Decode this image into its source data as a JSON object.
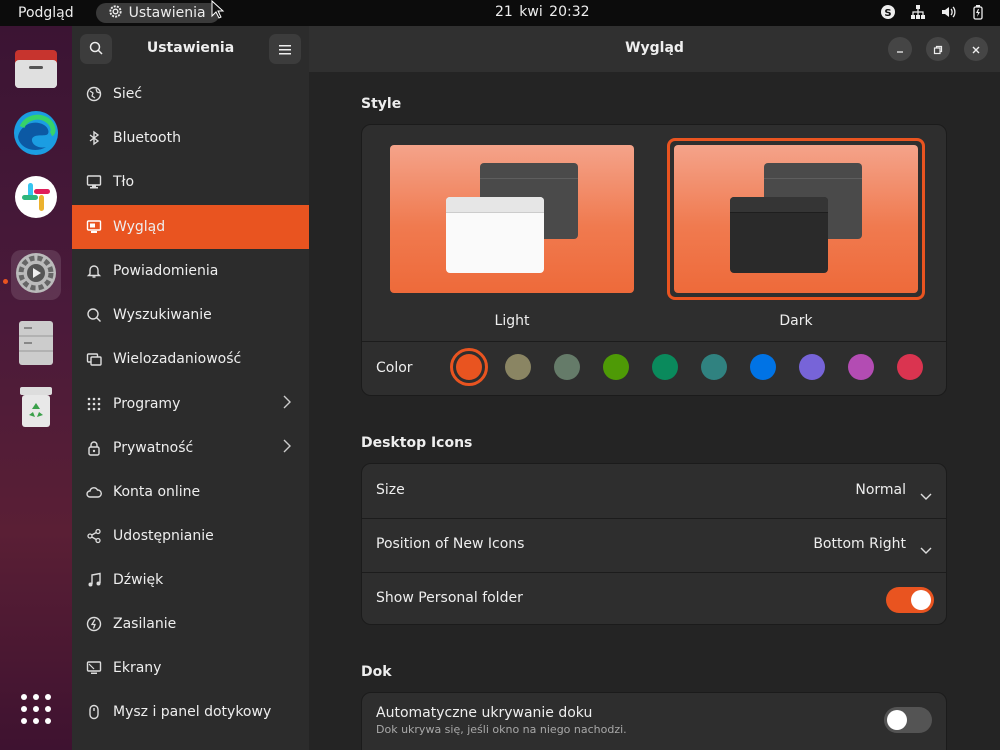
{
  "topbar": {
    "activities": "Podgląd",
    "app_name": "Ustawienia",
    "clock": "21 kwi  20:32"
  },
  "sidebar": {
    "title": "Ustawienia",
    "items": [
      {
        "label": "Sieć",
        "icon": "network-icon"
      },
      {
        "label": "Bluetooth",
        "icon": "bluetooth-icon"
      },
      {
        "label": "Tło",
        "icon": "background-icon"
      },
      {
        "label": "Wygląd",
        "icon": "appearance-icon",
        "active": true
      },
      {
        "label": "Powiadomienia",
        "icon": "bell-icon"
      },
      {
        "label": "Wyszukiwanie",
        "icon": "search-icon"
      },
      {
        "label": "Wielozadaniowość",
        "icon": "multitasking-icon"
      },
      {
        "label": "Programy",
        "icon": "apps-grid-icon",
        "chevron": true
      },
      {
        "label": "Prywatność",
        "icon": "lock-icon",
        "chevron": true
      },
      {
        "label": "Konta online",
        "icon": "cloud-icon"
      },
      {
        "label": "Udostępnianie",
        "icon": "share-icon"
      },
      {
        "label": "Dźwięk",
        "icon": "music-note-icon"
      },
      {
        "label": "Zasilanie",
        "icon": "power-icon"
      },
      {
        "label": "Ekrany",
        "icon": "display-icon"
      },
      {
        "label": "Mysz i panel dotykowy",
        "icon": "mouse-icon"
      }
    ]
  },
  "main": {
    "title": "Wygląd",
    "style_section": {
      "title": "Style",
      "options": [
        {
          "label": "Light",
          "selected": false
        },
        {
          "label": "Dark",
          "selected": true
        }
      ],
      "color_label": "Color",
      "colors": [
        "#e95420",
        "#8a8563",
        "#657b69",
        "#4e9a06",
        "#0a8a5c",
        "#308280",
        "#0073e5",
        "#7764d8",
        "#b34cb3",
        "#da3450"
      ],
      "selected_color": "#e95420"
    },
    "desktop_icons": {
      "title": "Desktop Icons",
      "size_label": "Size",
      "size_value": "Normal",
      "position_label": "Position of New Icons",
      "position_value": "Bottom Right",
      "personal_folder_label": "Show Personal folder",
      "personal_folder_on": true
    },
    "dock": {
      "title": "Dok",
      "autohide_label": "Automatyczne ukrywanie doku",
      "autohide_sub": "Dok ukrywa się, jeśli okno na niego nachodzi.",
      "autohide_on": false
    }
  },
  "colors": {
    "accent": "#e95420",
    "sidebar_bg": "#2c2c2c",
    "main_bg": "#242424",
    "card_bg": "#2e2e2e"
  }
}
